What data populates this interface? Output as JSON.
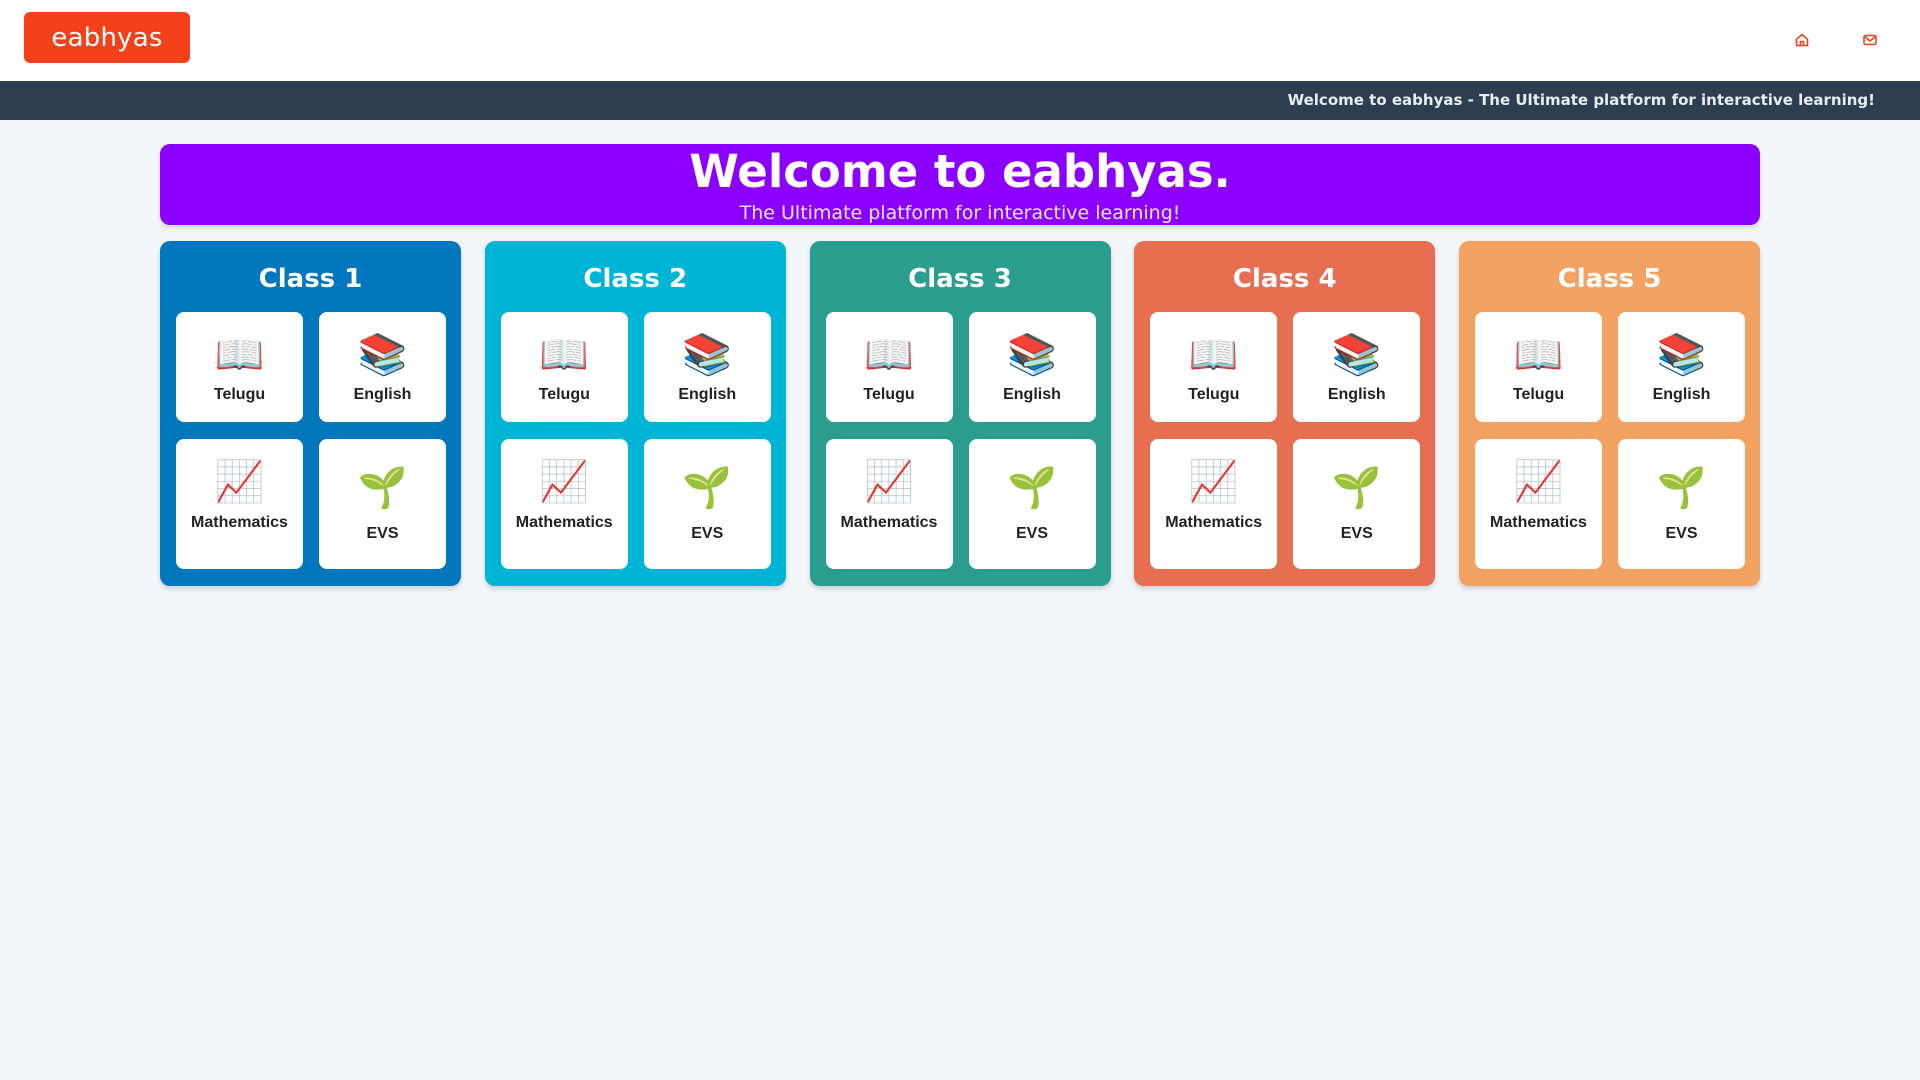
{
  "header": {
    "logo_text": "eabhyas",
    "home_icon": "home-icon",
    "mail_icon": "mail-icon",
    "accent_color": "#f4411a"
  },
  "ticker": {
    "text": "Welcome to eabhyas - The Ultimate platform for interactive learning!"
  },
  "banner": {
    "title": "Welcome to eabhyas.",
    "subtitle": "The Ultimate platform for interactive learning!",
    "color": "#8c00ff"
  },
  "classes": [
    {
      "title": "Class 1",
      "color": "#0277bd",
      "subjects": [
        {
          "label": "Telugu",
          "icon": "open-book-icon"
        },
        {
          "label": "English",
          "icon": "books-icon"
        },
        {
          "label": "Mathematics",
          "icon": "chart-increasing-icon"
        },
        {
          "label": "EVS",
          "icon": "seedling-icon"
        }
      ]
    },
    {
      "title": "Class 2",
      "color": "#00b4d8",
      "subjects": [
        {
          "label": "Telugu",
          "icon": "open-book-icon"
        },
        {
          "label": "English",
          "icon": "books-icon"
        },
        {
          "label": "Mathematics",
          "icon": "chart-increasing-icon"
        },
        {
          "label": "EVS",
          "icon": "seedling-icon"
        }
      ]
    },
    {
      "title": "Class 3",
      "color": "#2a9d8f",
      "subjects": [
        {
          "label": "Telugu",
          "icon": "open-book-icon"
        },
        {
          "label": "English",
          "icon": "books-icon"
        },
        {
          "label": "Mathematics",
          "icon": "chart-increasing-icon"
        },
        {
          "label": "EVS",
          "icon": "seedling-icon"
        }
      ]
    },
    {
      "title": "Class 4",
      "color": "#e76f51",
      "subjects": [
        {
          "label": "Telugu",
          "icon": "open-book-icon"
        },
        {
          "label": "English",
          "icon": "books-icon"
        },
        {
          "label": "Mathematics",
          "icon": "chart-increasing-icon"
        },
        {
          "label": "EVS",
          "icon": "seedling-icon"
        }
      ]
    },
    {
      "title": "Class 5",
      "color": "#f4a261",
      "subjects": [
        {
          "label": "Telugu",
          "icon": "open-book-icon"
        },
        {
          "label": "English",
          "icon": "books-icon"
        },
        {
          "label": "Mathematics",
          "icon": "chart-increasing-icon"
        },
        {
          "label": "EVS",
          "icon": "seedling-icon"
        }
      ]
    }
  ]
}
